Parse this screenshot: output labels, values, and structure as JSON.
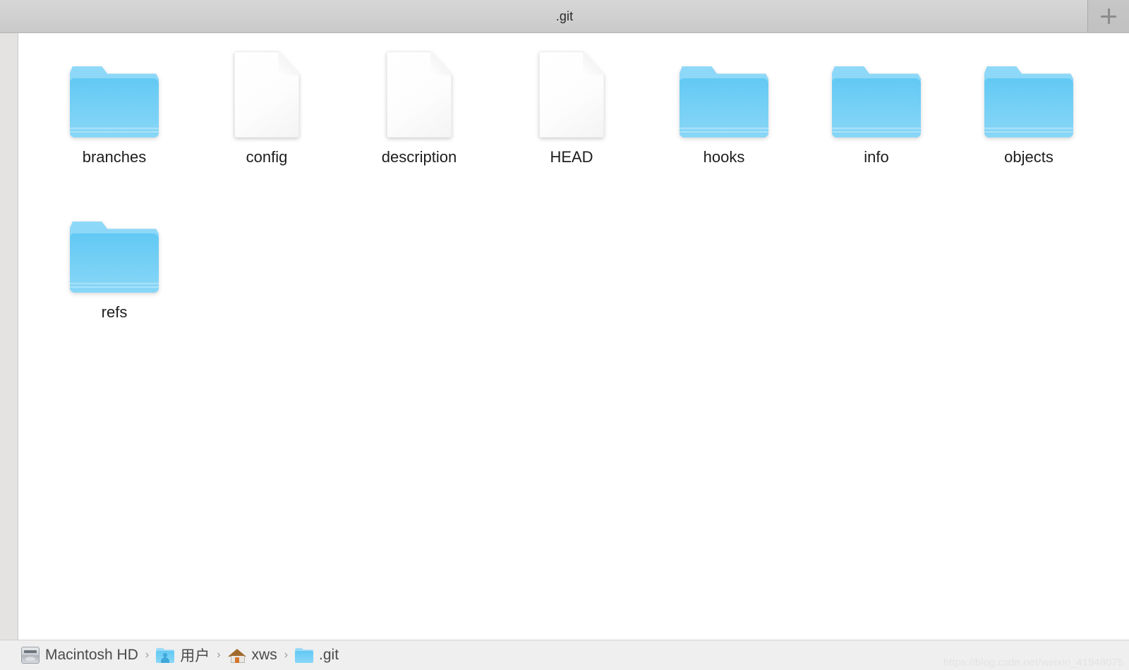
{
  "window": {
    "title": ".git",
    "new_tab_icon": "plus-icon",
    "new_tab_label": "+"
  },
  "files": [
    {
      "name": "branches",
      "type": "folder",
      "icon": "folder-icon"
    },
    {
      "name": "config",
      "type": "document",
      "icon": "document-icon"
    },
    {
      "name": "description",
      "type": "document",
      "icon": "document-icon"
    },
    {
      "name": "HEAD",
      "type": "document",
      "icon": "document-icon"
    },
    {
      "name": "hooks",
      "type": "folder",
      "icon": "folder-icon"
    },
    {
      "name": "info",
      "type": "folder",
      "icon": "folder-icon"
    },
    {
      "name": "objects",
      "type": "folder",
      "icon": "folder-icon"
    },
    {
      "name": "refs",
      "type": "folder",
      "icon": "folder-icon"
    }
  ],
  "pathbar": {
    "separator": "›",
    "crumbs": [
      {
        "label": "Macintosh HD",
        "icon": "hard-disk-icon"
      },
      {
        "label": "用户",
        "icon": "users-folder-icon"
      },
      {
        "label": "xws",
        "icon": "home-icon"
      },
      {
        "label": ".git",
        "icon": "folder-icon"
      }
    ]
  },
  "watermark": "https://blog.csdn.net/weixin_41948075",
  "colors": {
    "titlebar_bg": "#d2d2d2",
    "content_bg": "#ffffff",
    "sidebar_strip": "#e4e3e1",
    "pathbar_bg": "#efefef",
    "folder_blue": "#6ecdf5",
    "folder_tab_blue": "#8ed8f8",
    "label_text": "#1d1d1d",
    "path_text": "#4a4a4a",
    "watermark_text": "#e3e3e3"
  }
}
